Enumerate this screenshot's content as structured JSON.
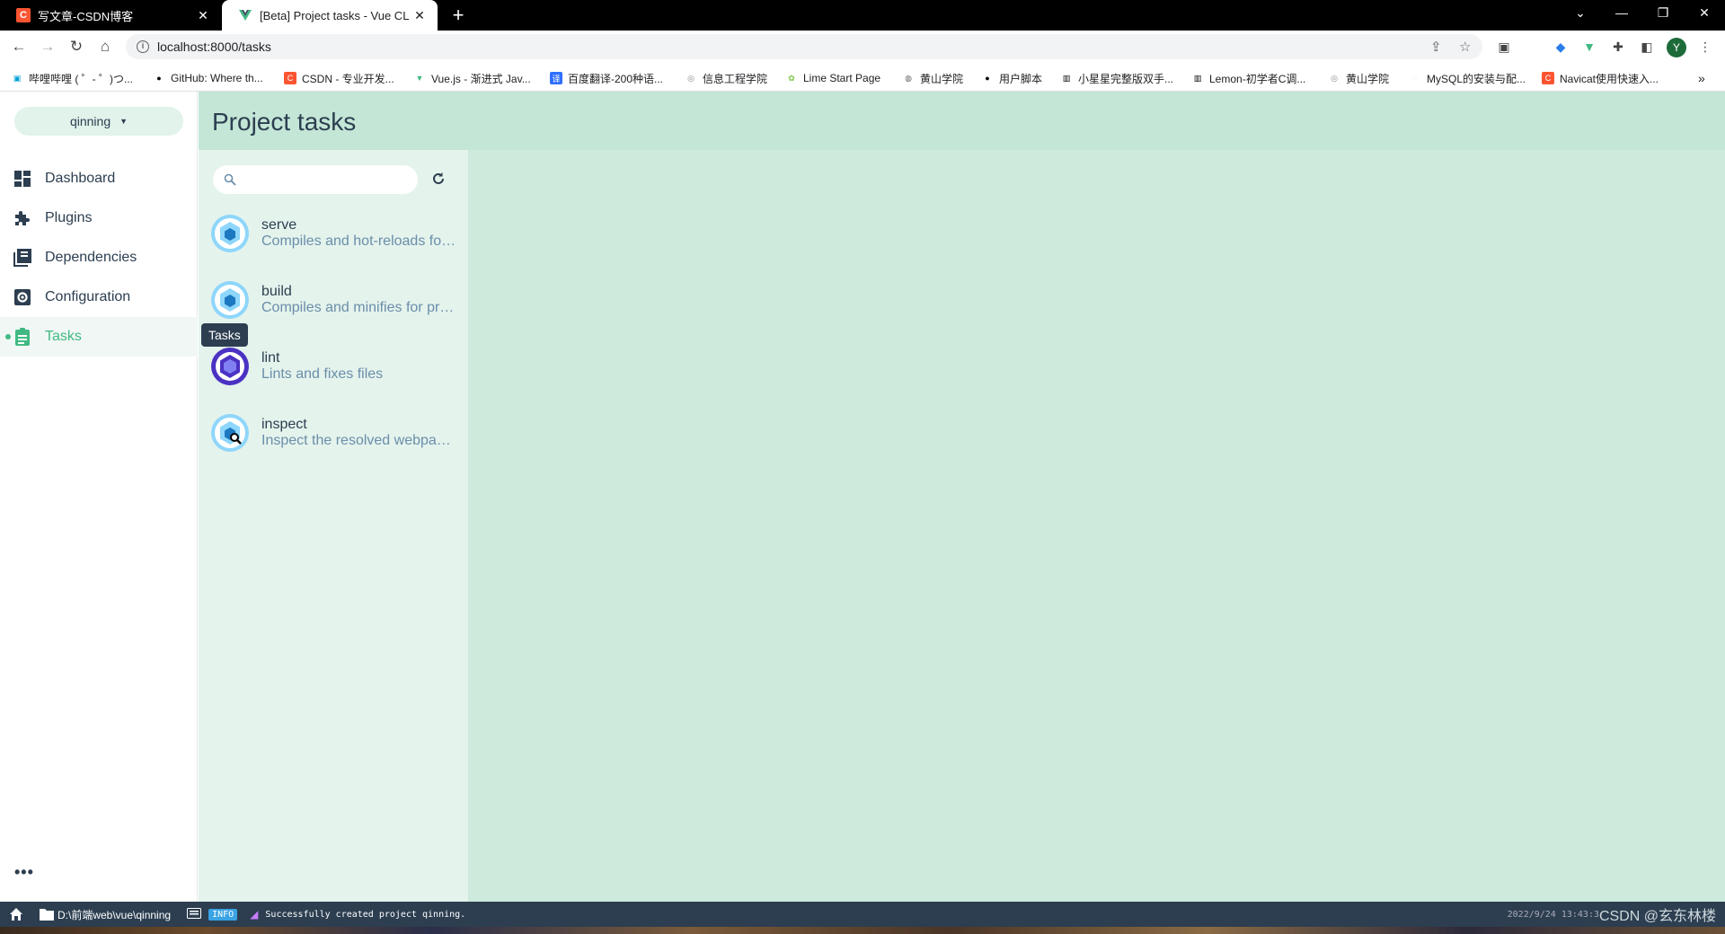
{
  "browser": {
    "tabs": [
      {
        "title": "写文章-CSDN博客",
        "favicon": "csdn-icon"
      },
      {
        "title": "[Beta] Project tasks - Vue CLI",
        "favicon": "vue-icon"
      }
    ],
    "url": "localhost:8000/tasks",
    "profile_initial": "Y",
    "bookmarks": [
      "哔哩哔哩 ( ゜- ゜)つ...",
      "GitHub: Where th...",
      "CSDN - 专业开发...",
      "Vue.js - 渐进式 Jav...",
      "百度翻译-200种语...",
      "信息工程学院",
      "Lime Start Page",
      "黄山学院",
      "用户脚本",
      "小星星完整版双手...",
      "Lemon-初学者C调...",
      "黄山学院",
      "MySQL的安装与配...",
      "Navicat使用快速入..."
    ]
  },
  "sidebar": {
    "project_name": "qinning",
    "items": [
      {
        "label": "Dashboard",
        "icon": "dashboard-icon"
      },
      {
        "label": "Plugins",
        "icon": "puzzle-icon"
      },
      {
        "label": "Dependencies",
        "icon": "library-icon"
      },
      {
        "label": "Configuration",
        "icon": "settings-icon"
      },
      {
        "label": "Tasks",
        "icon": "assignment-icon",
        "active": true
      }
    ],
    "tooltip": "Tasks"
  },
  "page": {
    "title": "Project tasks",
    "search_value": ""
  },
  "tasks": [
    {
      "name": "serve",
      "description": "Compiles and hot-reloads for development",
      "icon": "webpack-icon"
    },
    {
      "name": "build",
      "description": "Compiles and minifies for production",
      "icon": "webpack-icon"
    },
    {
      "name": "lint",
      "description": "Lints and fixes files",
      "icon": "eslint-icon"
    },
    {
      "name": "inspect",
      "description": "Inspect the resolved webpack config",
      "icon": "webpack-inspect-icon"
    }
  ],
  "statusbar": {
    "path": "D:\\前端web\\vue\\qinning",
    "log_level": "INFO",
    "message": "Successfully created project qinning.",
    "timestamp": "2022/9/24 13:43:3",
    "watermark": "CSDN @玄东林楼"
  },
  "colors": {
    "accent": "#42b983",
    "header_bg": "#c4e6d6",
    "tasklist_bg": "#e4f3ec",
    "main_bg": "#cdeadd",
    "statusbar_bg": "#2c3e50"
  }
}
